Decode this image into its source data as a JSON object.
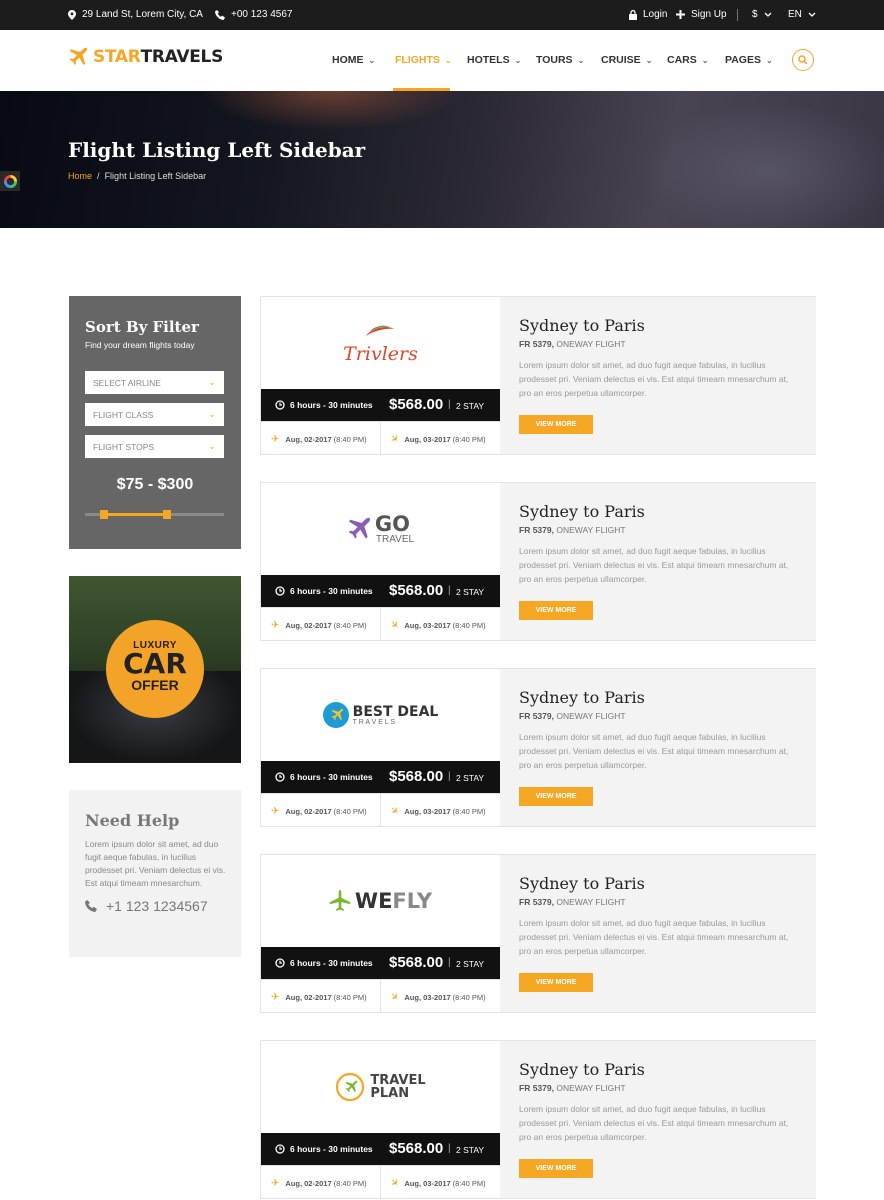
{
  "topbar": {
    "address": "29 Land St, Lorem City, CA",
    "phone": "+00 123 4567",
    "login": "Login",
    "signup": "Sign Up",
    "currency": "$",
    "language": "EN"
  },
  "brand": {
    "part1": "STAR",
    "part2": "TRAVELS",
    "accent": "#f5a623"
  },
  "nav": {
    "home": "HOME",
    "flights": "FLIGHTS",
    "hotels": "HOTELS",
    "tours": "TOURS",
    "cruise": "CRUISE",
    "cars": "CARS",
    "pages": "PAGES",
    "active": "FLIGHTS"
  },
  "hero": {
    "title": "Flight Listing Left Sidebar",
    "crumb_home": "Home",
    "crumb_sep": "/",
    "crumb_current": "Flight Listing Left Sidebar"
  },
  "filter": {
    "title": "Sort By Filter",
    "subtitle": "Find your dream flights today",
    "airline": "SELECT AIRLINE",
    "class": "FLIGHT CLASS",
    "stops": "FLIGHT STOPS",
    "price_range": "$75 - $300"
  },
  "promo": {
    "line1": "LUXURY",
    "line2": "CAR",
    "line3": "OFFER"
  },
  "help": {
    "title": "Need Help",
    "text": "Lorem ipsum dolor sit amet, ad duo fugit aeque fabulas, in lucilius prodesset pri. Veniam delectus ei vis. Est atqui timeam mnesarchum.",
    "phone": "+1 123 1234567"
  },
  "flights": [
    {
      "logo_a": "Trivlers",
      "logo_b": "",
      "duration": "6 hours - 30 minutes",
      "price": "$568.00",
      "stay": "2 STAY",
      "depart_date": "Aug, 02-2017",
      "depart_time": "(8:40 PM)",
      "arrive_date": "Aug, 03-2017",
      "arrive_time": "(8:40 PM)",
      "route": "Sydney to Paris",
      "code": "FR 5379,",
      "type": " ONEWAY FLIGHT",
      "desc": "Lorem ipsum dolor sit amet, ad duo fugit aeque fabulas, in lucilius prodesset pri. Veniam delectus ei vis. Est atqui timeam mnesarchum at, pro an eros perpetua ullamcorper.",
      "button": "VIEW MORE"
    },
    {
      "logo_a": "GO",
      "logo_b": "TRAVEL",
      "duration": "6 hours - 30 minutes",
      "price": "$568.00",
      "stay": "2 STAY",
      "depart_date": "Aug, 02-2017",
      "depart_time": "(8:40 PM)",
      "arrive_date": "Aug, 03-2017",
      "arrive_time": "(8:40 PM)",
      "route": "Sydney to Paris",
      "code": "FR 5379,",
      "type": " ONEWAY FLIGHT",
      "desc": "Lorem ipsum dolor sit amet, ad duo fugit aeque fabulas, in lucilius prodesset pri. Veniam delectus ei vis. Est atqui timeam mnesarchum at, pro an eros perpetua ullamcorper.",
      "button": "VIEW MORE"
    },
    {
      "logo_a": "BEST DEAL",
      "logo_b": "T R A V E L S",
      "duration": "6 hours - 30 minutes",
      "price": "$568.00",
      "stay": "2 STAY",
      "depart_date": "Aug, 02-2017",
      "depart_time": "(8:40 PM)",
      "arrive_date": "Aug, 03-2017",
      "arrive_time": "(8:40 PM)",
      "route": "Sydney to Paris",
      "code": "FR 5379,",
      "type": " ONEWAY FLIGHT",
      "desc": "Lorem ipsum dolor sit amet, ad duo fugit aeque fabulas, in lucilius prodesset pri. Veniam delectus ei vis. Est atqui timeam mnesarchum at, pro an eros perpetua ullamcorper.",
      "button": "VIEW MORE"
    },
    {
      "logo_a": "WE",
      "logo_b": "FLY",
      "duration": "6 hours - 30 minutes",
      "price": "$568.00",
      "stay": "2 STAY",
      "depart_date": "Aug, 02-2017",
      "depart_time": "(8:40 PM)",
      "arrive_date": "Aug, 03-2017",
      "arrive_time": "(8:40 PM)",
      "route": "Sydney to Paris",
      "code": "FR 5379,",
      "type": " ONEWAY FLIGHT",
      "desc": "Lorem ipsum dolor sit amet, ad duo fugit aeque fabulas, in lucilius prodesset pri. Veniam delectus ei vis. Est atqui timeam mnesarchum at, pro an eros perpetua ullamcorper.",
      "button": "VIEW MORE"
    },
    {
      "logo_a": "TRAVEL",
      "logo_b": "PLAN",
      "duration": "6 hours - 30 minutes",
      "price": "$568.00",
      "stay": "2 STAY",
      "depart_date": "Aug, 02-2017",
      "depart_time": "(8:40 PM)",
      "arrive_date": "Aug, 03-2017",
      "arrive_time": "(8:40 PM)",
      "route": "Sydney to Paris",
      "code": "FR 5379,",
      "type": " ONEWAY FLIGHT",
      "desc": "Lorem ipsum dolor sit amet, ad duo fugit aeque fabulas, in lucilius prodesset pri. Veniam delectus ei vis. Est atqui timeam mnesarchum at, pro an eros perpetua ullamcorper.",
      "button": "VIEW MORE"
    }
  ]
}
